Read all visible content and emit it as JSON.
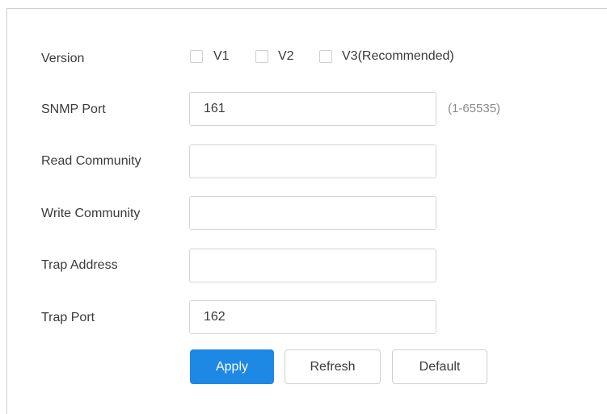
{
  "form": {
    "version_label": "Version",
    "versions": [
      {
        "label": "V1",
        "checked": false
      },
      {
        "label": "V2",
        "checked": false
      },
      {
        "label": "V3(Recommended)",
        "checked": false
      }
    ],
    "snmp_port": {
      "label": "SNMP Port",
      "value": "161",
      "hint": "(1-65535)"
    },
    "read_community": {
      "label": "Read Community",
      "value": ""
    },
    "write_community": {
      "label": "Write Community",
      "value": ""
    },
    "trap_address": {
      "label": "Trap Address",
      "value": ""
    },
    "trap_port": {
      "label": "Trap Port",
      "value": "162"
    }
  },
  "buttons": {
    "apply": "Apply",
    "refresh": "Refresh",
    "default": "Default"
  },
  "colors": {
    "primary": "#1e88e5",
    "border": "#d6d6d6",
    "text": "#3a3a3a",
    "hint": "#8a8a8a"
  }
}
